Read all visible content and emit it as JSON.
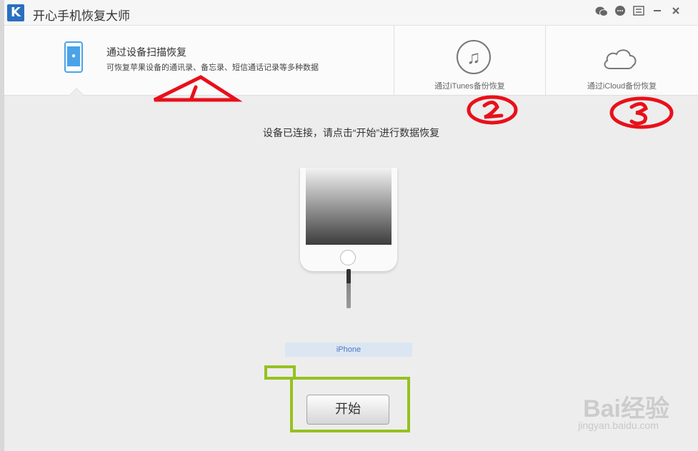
{
  "window": {
    "title": "开心手机恢复大师",
    "logo_letter": "K"
  },
  "title_icons": [
    "wechat-icon",
    "chat-icon",
    "menu-icon",
    "minimize-icon",
    "close-icon"
  ],
  "tabs": {
    "device": {
      "title": "通过设备扫描恢复",
      "desc": "可恢复苹果设备的通讯录、备忘录、短信通话记录等多种数据"
    },
    "itunes": {
      "label": "通过iTunes备份恢复"
    },
    "icloud": {
      "label": "通过iCloud备份恢复"
    }
  },
  "main": {
    "status": "设备已连接，请点击“开始”进行数据恢复",
    "device_name": "iPhone",
    "start_label": "开始"
  },
  "annotations": {
    "marks": [
      "1",
      "2",
      "3"
    ]
  },
  "watermark": {
    "text": "Bai经验",
    "url": "jingyan.baidu.com"
  },
  "colors": {
    "accent": "#4aa3e8",
    "annotation_red": "#e8101a",
    "annotation_green": "#96c11f"
  }
}
